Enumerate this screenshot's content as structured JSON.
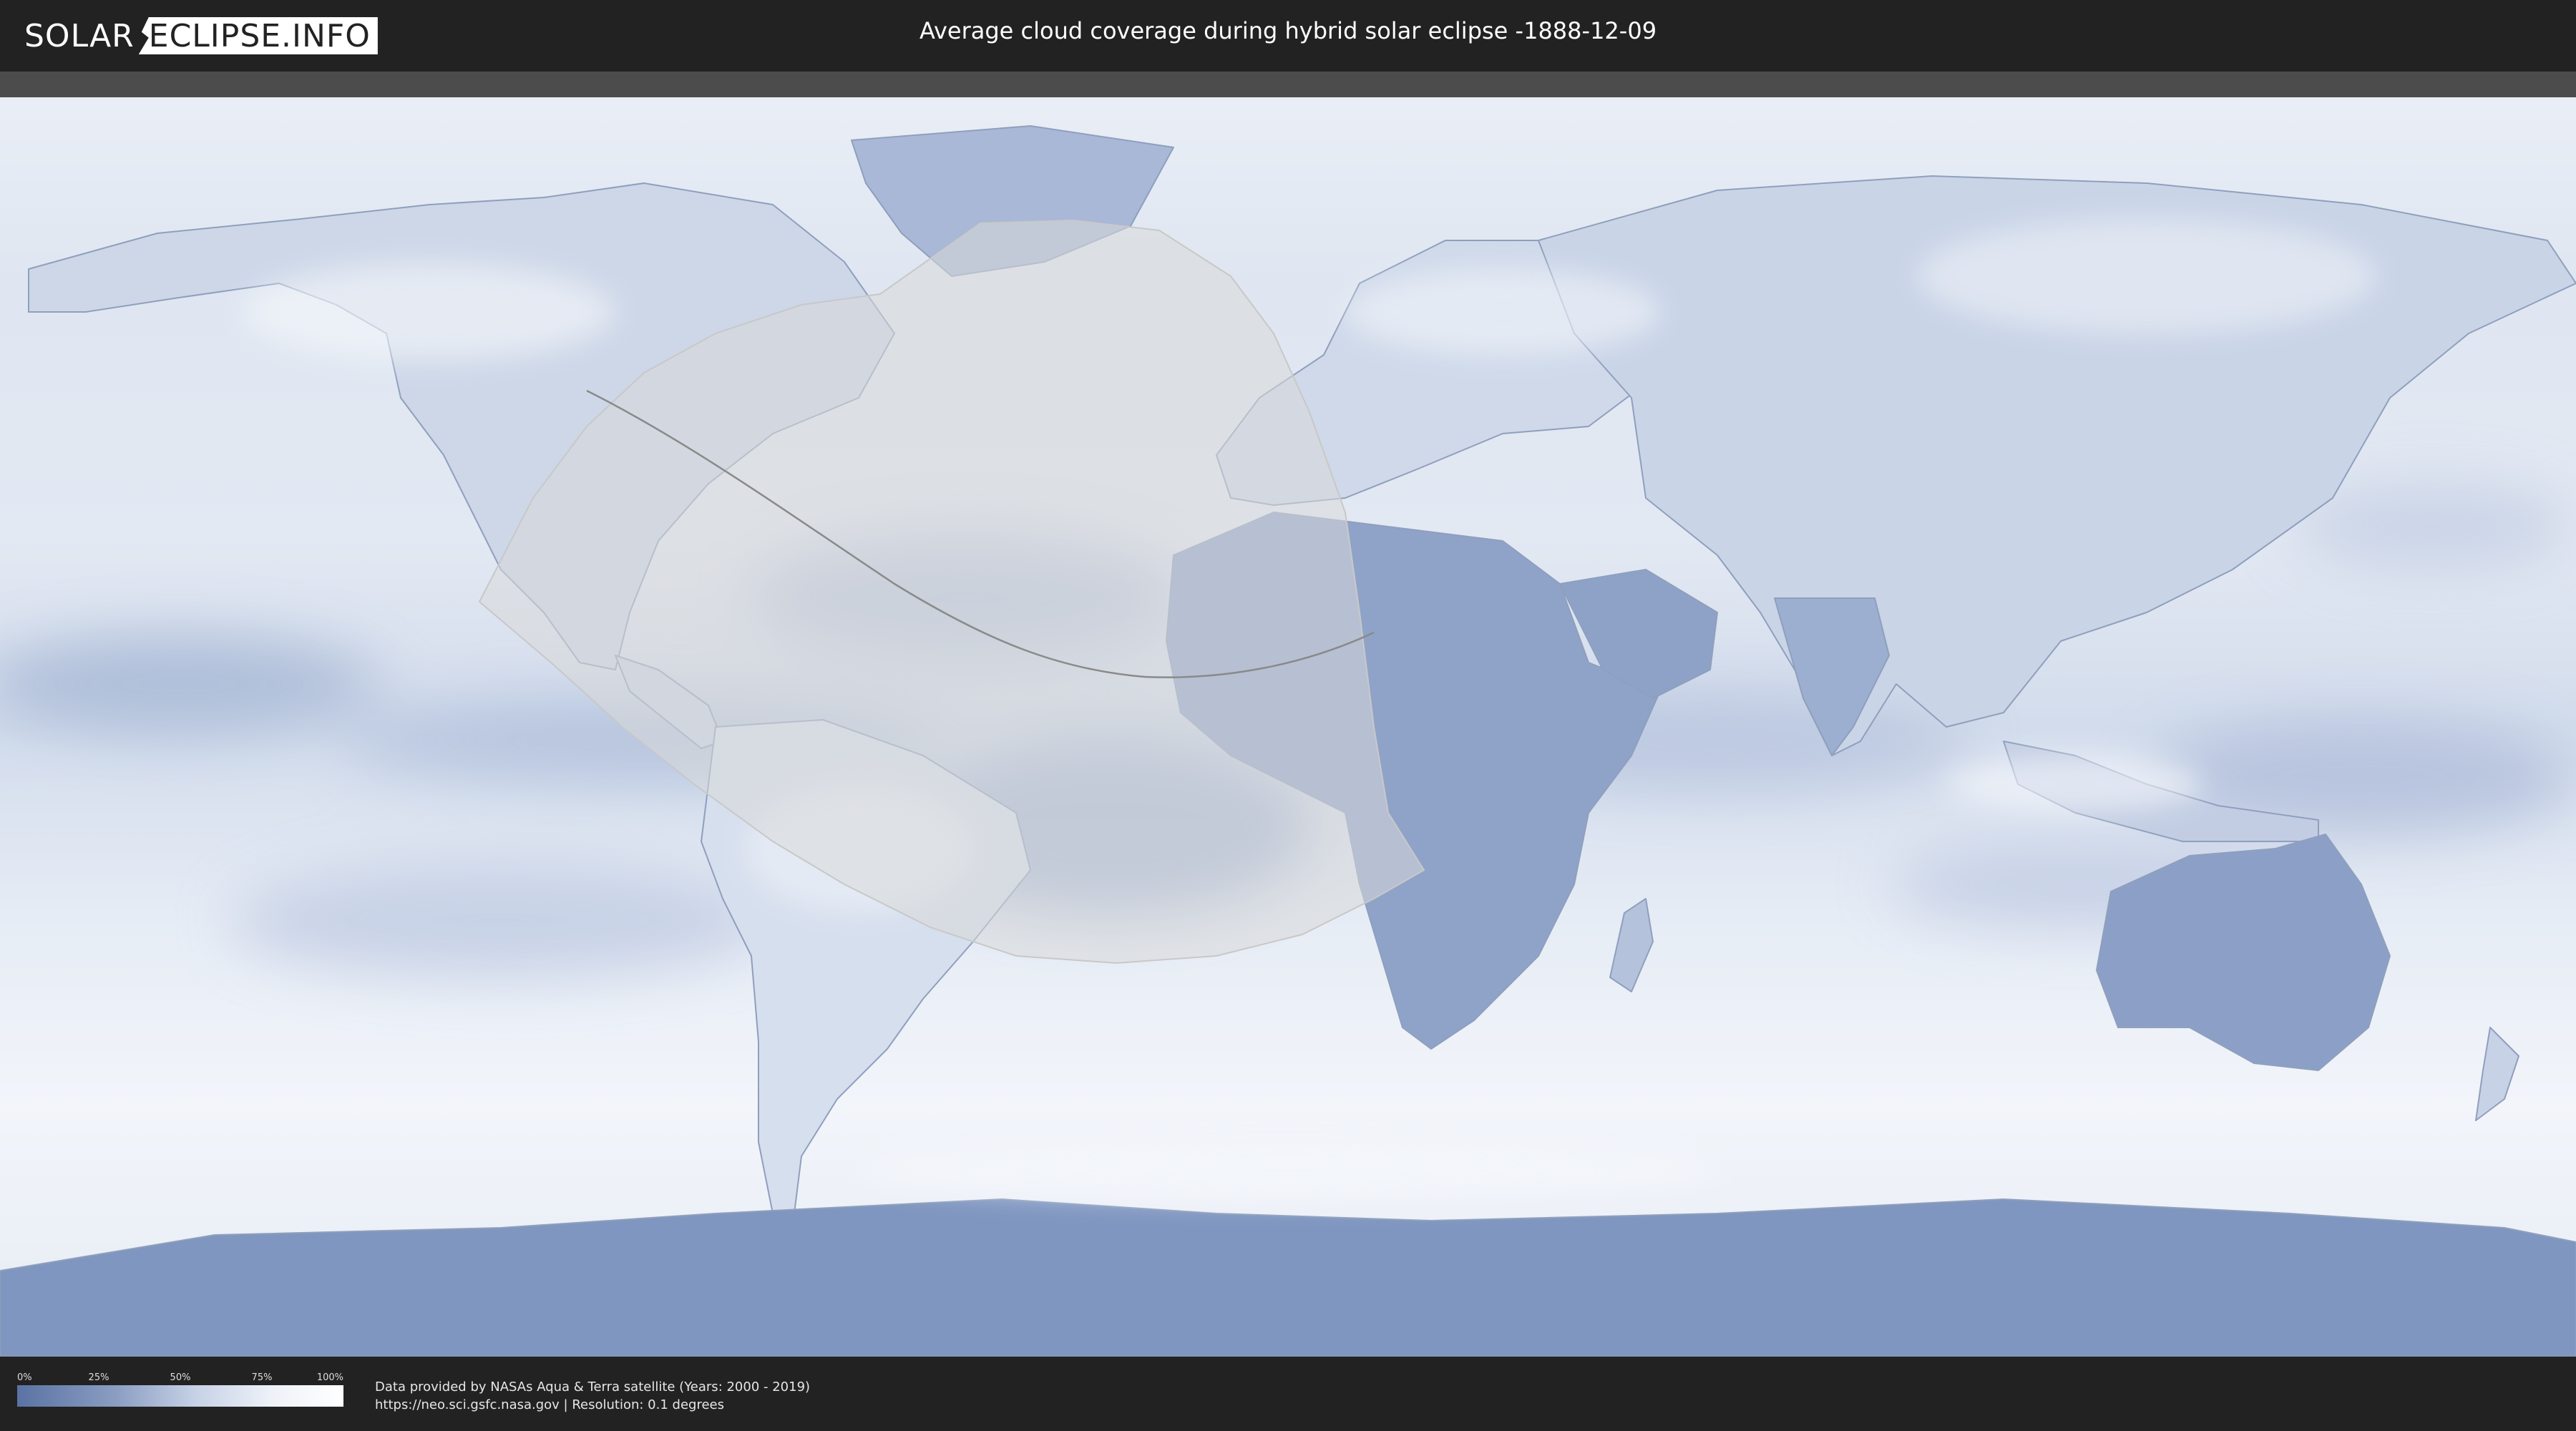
{
  "header": {
    "logo_left": "SOLAR",
    "logo_right": "ECLIPSE.INFO",
    "title": "Average cloud coverage during hybrid solar eclipse -1888-12-09"
  },
  "legend": {
    "ticks": [
      "0%",
      "25%",
      "50%",
      "75%",
      "100%"
    ],
    "colors": [
      "#5a73a3",
      "#ffffff"
    ]
  },
  "credits": {
    "line1": "Data provided by NASAs Aqua & Terra satellite (Years: 2000 - 2019)",
    "line2": "https://neo.sci.gsfc.nasa.gov | Resolution: 0.1 degrees"
  },
  "map": {
    "colors": {
      "ocean_clear": "#6d86b6",
      "cloud": "#eef2f8",
      "land_dry": "#6f87b8",
      "eclipse_overlay": "#d9d9d9",
      "borders": "#8899b8"
    }
  }
}
